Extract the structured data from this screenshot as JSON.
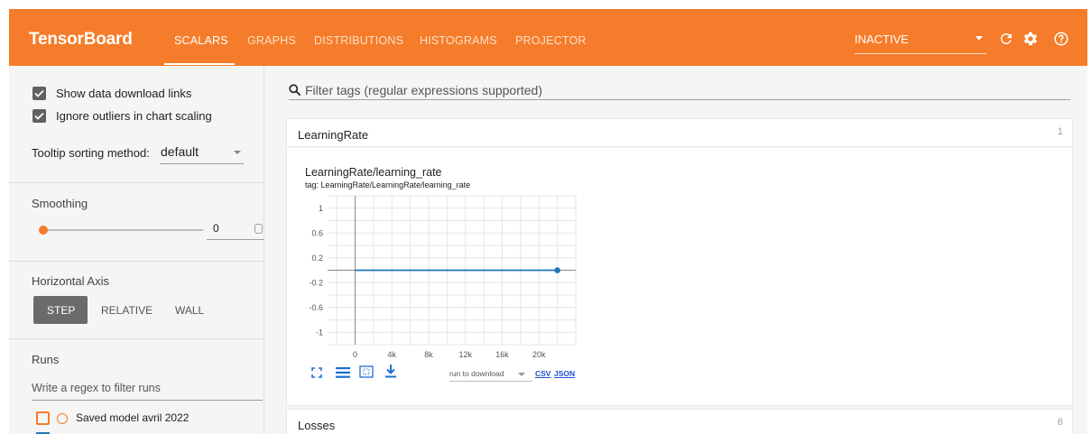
{
  "header": {
    "brand": "TensorBoard",
    "tabs": [
      {
        "label": "SCALARS"
      },
      {
        "label": "GRAPHS"
      },
      {
        "label": "DISTRIBUTIONS"
      },
      {
        "label": "HISTOGRAMS"
      },
      {
        "label": "PROJECTOR"
      }
    ],
    "status_select": "INACTIVE",
    "accent_color": "#f57c2a"
  },
  "sidebar": {
    "show_download_links": {
      "label": "Show data download links",
      "checked": true
    },
    "ignore_outliers": {
      "label": "Ignore outliers in chart scaling",
      "checked": true
    },
    "tooltip": {
      "label": "Tooltip sorting method:",
      "value": "default"
    },
    "smoothing": {
      "label": "Smoothing",
      "value": "0"
    },
    "horizontal_axis": {
      "label": "Horizontal Axis",
      "options": [
        "STEP",
        "RELATIVE",
        "WALL"
      ],
      "selected": "STEP"
    },
    "runs": {
      "label": "Runs",
      "filter_placeholder": "Write a regex to filter runs",
      "items": [
        {
          "label": "Saved model avril 2022",
          "checked": false
        }
      ]
    }
  },
  "main": {
    "search_placeholder": "Filter tags (regular expressions supported)",
    "cards": [
      {
        "title": "LearningRate",
        "count": "1"
      },
      {
        "title": "Losses",
        "count": "6"
      }
    ],
    "chart": {
      "title": "LearningRate/learning_rate",
      "tag": "tag: LearningRate/LearningRate/learning_rate",
      "run_select": "run to download",
      "csv_label": "CSV",
      "json_label": "JSON",
      "series_color": "#1f77b4"
    }
  },
  "chart_data": {
    "type": "line",
    "title": "LearningRate/learning_rate",
    "xlabel": "",
    "ylabel": "",
    "x_ticks": [
      "0",
      "4k",
      "8k",
      "12k",
      "16k",
      "20k"
    ],
    "y_ticks": [
      "1",
      "0.6",
      "0.2",
      "-0.2",
      "-0.6",
      "-1"
    ],
    "xlim": [
      -3000,
      24000
    ],
    "ylim": [
      -1.2,
      1.2
    ],
    "grid": true,
    "series": [
      {
        "x": [
          0,
          22000
        ],
        "y": [
          0,
          0
        ]
      }
    ]
  }
}
